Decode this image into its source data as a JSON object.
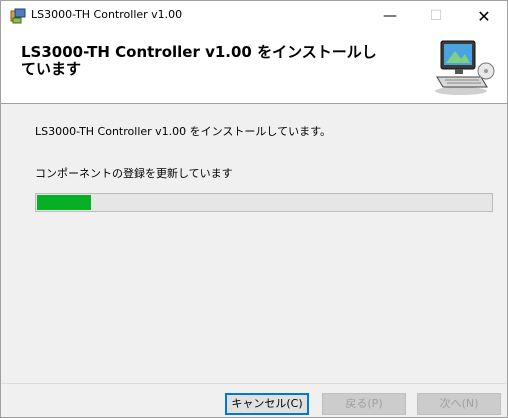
{
  "window": {
    "title": "LS3000-TH Controller v1.00",
    "controls": {
      "minimize": "—",
      "maximize": "☐",
      "close": "✕"
    }
  },
  "banner": {
    "title": "LS3000-TH Controller v1.00 をインストールしています",
    "graphic_icon": "computer-install-icon"
  },
  "body": {
    "status_text": "LS3000-TH Controller v1.00 をインストールしています。",
    "action_text": "コンポーネントの登録を更新しています",
    "progress_fraction": 0.12,
    "progress_color": "#06b025"
  },
  "buttons": {
    "cancel": "キャンセル(C)",
    "back": "戻る(P)",
    "next": "次へ(N)"
  },
  "colors": {
    "focus_border": "#0078d7"
  }
}
